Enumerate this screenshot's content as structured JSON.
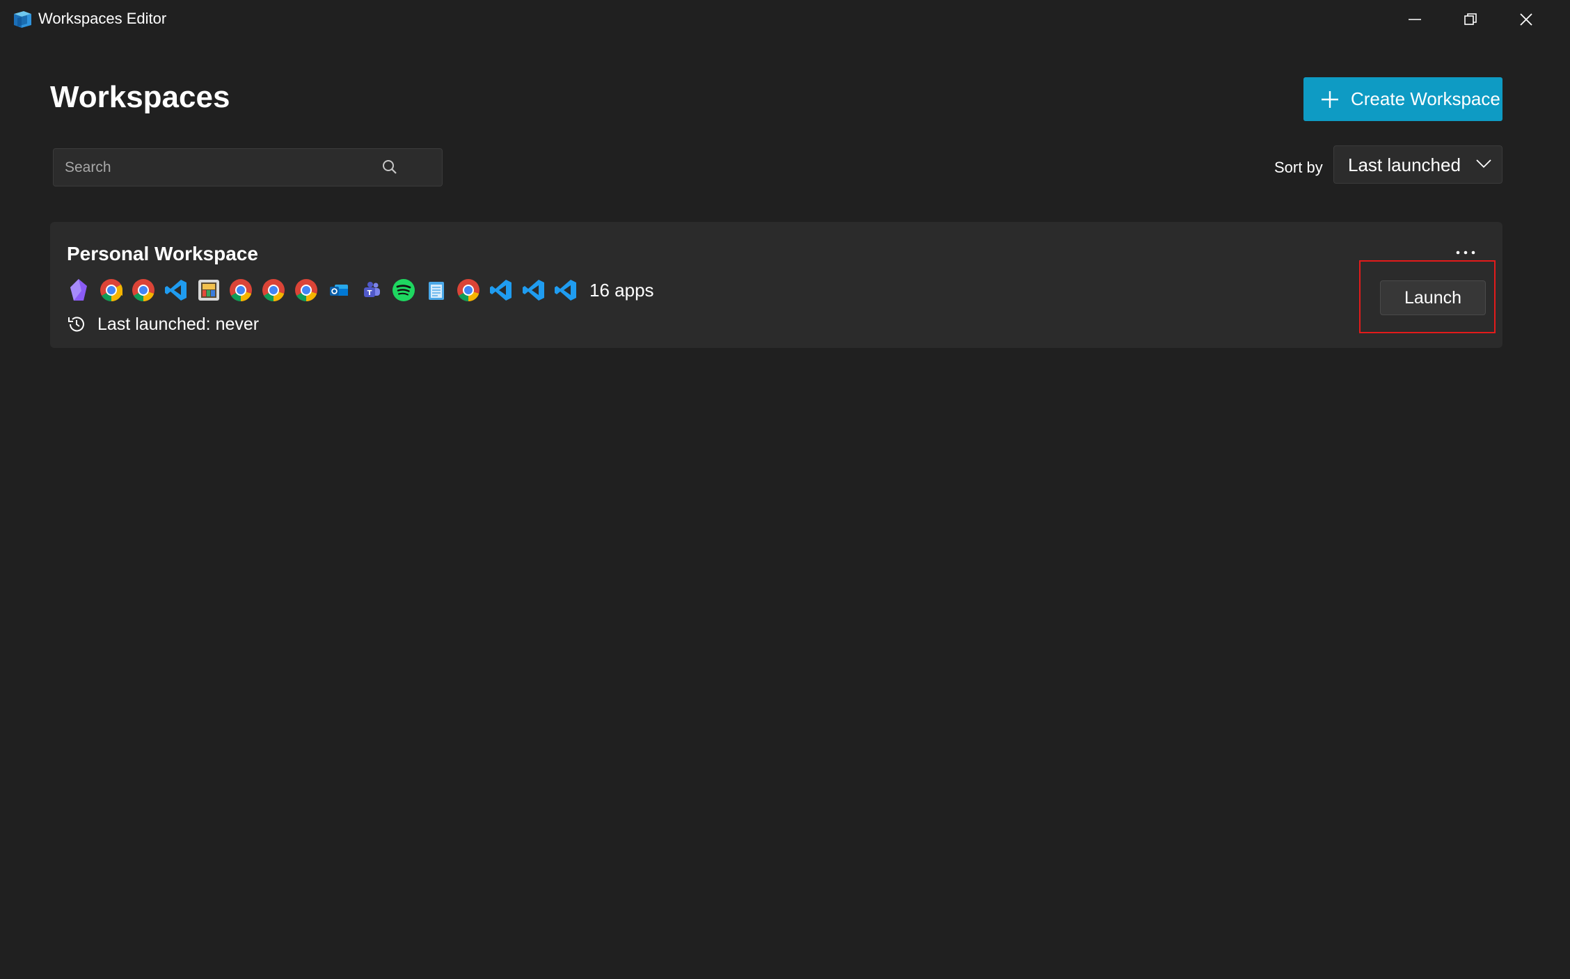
{
  "window": {
    "title": "Workspaces Editor",
    "icon": "workspaces-app-icon",
    "controls": [
      "minimize-icon",
      "restore-icon",
      "close-icon"
    ]
  },
  "page": {
    "title": "Workspaces",
    "create_button": {
      "label": "Create Workspace",
      "icon": "plus-icon"
    }
  },
  "search": {
    "placeholder": "Search",
    "value": "",
    "icon": "search-icon"
  },
  "sort": {
    "label": "Sort by",
    "selected": "Last launched",
    "icon": "chevron-down-icon"
  },
  "workspaces": [
    {
      "name": "Personal Workspace",
      "apps": [
        "obsidian",
        "chrome",
        "chrome",
        "vscode",
        "photos",
        "chrome",
        "chrome",
        "chrome",
        "outlook",
        "teams",
        "spotify",
        "notepad",
        "chrome",
        "vscode",
        "vscode",
        "vscode"
      ],
      "apps_count": "16 apps",
      "last_launched": "Last launched: never",
      "launch_label": "Launch",
      "more_icon": "more-icon",
      "history_icon": "history-icon"
    }
  ],
  "colors": {
    "background": "#202020",
    "card": "#2b2b2b",
    "accent": "#0e9bc4",
    "highlight": "#e31b1b"
  }
}
